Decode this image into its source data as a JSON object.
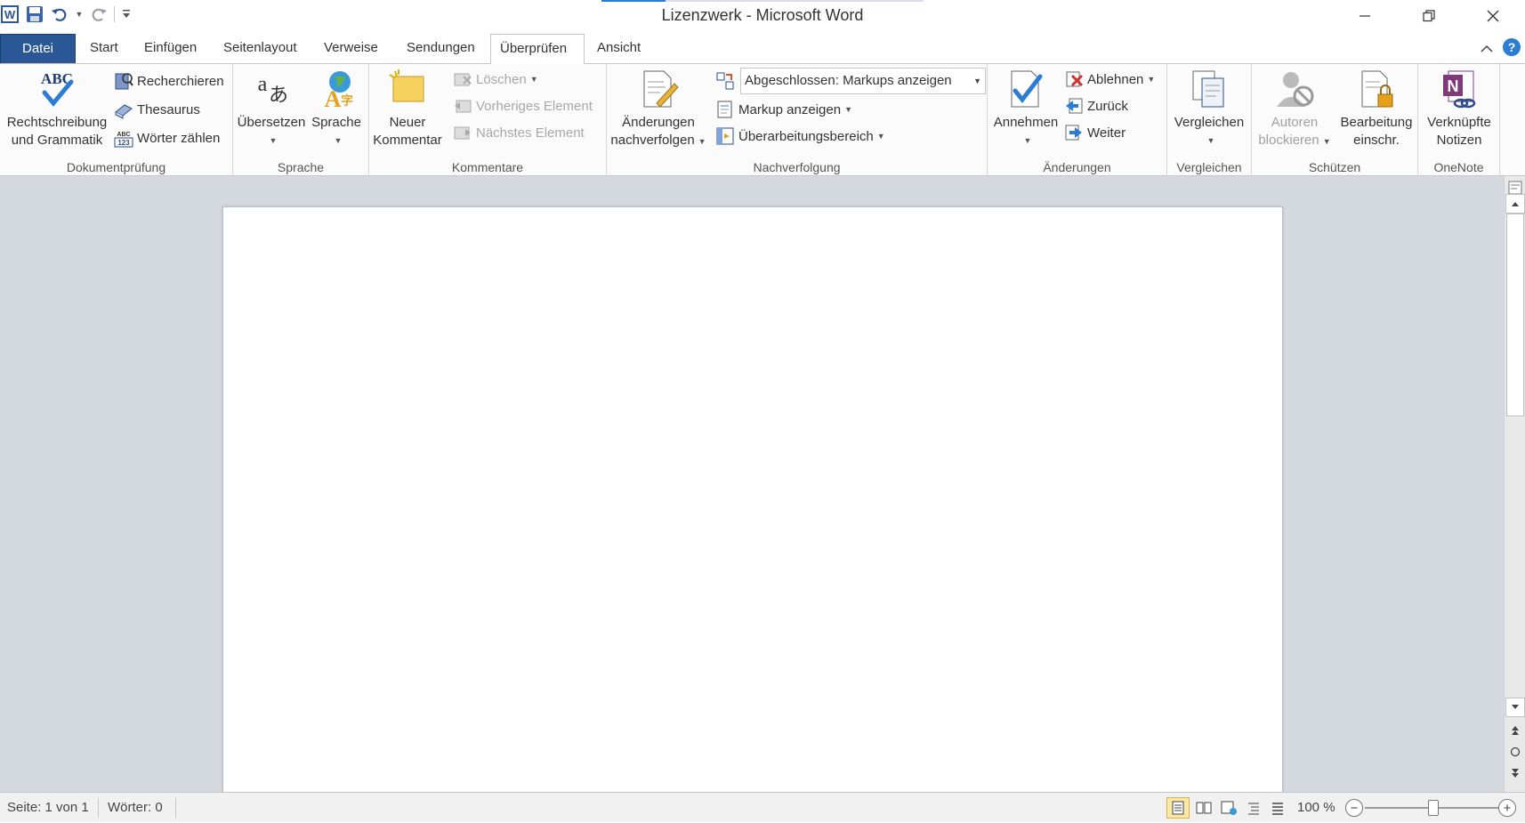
{
  "window": {
    "title": "Lizenzwerk - Microsoft Word"
  },
  "tabs": {
    "file": "Datei",
    "items": [
      "Start",
      "Einfügen",
      "Seitenlayout",
      "Verweise",
      "Sendungen",
      "Überprüfen",
      "Ansicht"
    ],
    "active": "Überprüfen"
  },
  "ribbon": {
    "dokumentpruefung": {
      "label": "Dokumentprüfung",
      "spelling_line1": "Rechtschreibung",
      "spelling_line2": "und Grammatik",
      "research": "Recherchieren",
      "thesaurus": "Thesaurus",
      "wordcount": "Wörter zählen"
    },
    "sprache": {
      "label": "Sprache",
      "translate": "Übersetzen",
      "language": "Sprache"
    },
    "kommentare": {
      "label": "Kommentare",
      "new_line1": "Neuer",
      "new_line2": "Kommentar",
      "delete": "Löschen",
      "previous": "Vorheriges Element",
      "next": "Nächstes Element"
    },
    "nachverfolgung": {
      "label": "Nachverfolgung",
      "track_line1": "Änderungen",
      "track_line2": "nachverfolgen",
      "display_value": "Abgeschlossen: Markups anzeigen",
      "show_markup": "Markup anzeigen",
      "review_pane": "Überarbeitungsbereich"
    },
    "aenderungen": {
      "label": "Änderungen",
      "accept": "Annehmen",
      "reject": "Ablehnen",
      "previous": "Zurück",
      "next": "Weiter"
    },
    "vergleichen": {
      "label": "Vergleichen",
      "compare": "Vergleichen"
    },
    "schuetzen": {
      "label": "Schützen",
      "block_line1": "Autoren",
      "block_line2": "blockieren",
      "restrict_line1": "Bearbeitung",
      "restrict_line2": "einschr."
    },
    "onenote": {
      "label": "OneNote",
      "linked_line1": "Verknüpfte",
      "linked_line2": "Notizen"
    }
  },
  "status": {
    "page": "Seite: 1 von 1",
    "words": "Wörter: 0",
    "zoom": "100 %"
  },
  "colors": {
    "file_tab": "#2b5797",
    "doc_background": "#d5d9e0"
  }
}
